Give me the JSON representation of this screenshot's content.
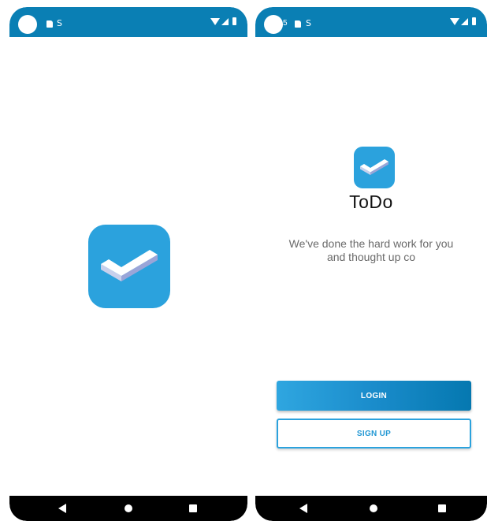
{
  "left_screen": {
    "status_bar": {
      "icons": [
        "camera-cutout",
        "sd-card-icon",
        "s-icon",
        "wifi-icon",
        "signal-icon",
        "battery-icon"
      ]
    },
    "splash_logo": "todo-check-icon",
    "nav_bar": {
      "icons": [
        "back-icon",
        "home-icon",
        "recents-icon"
      ]
    }
  },
  "right_screen": {
    "status_bar": {
      "time_fragment": "5",
      "icons": [
        "camera-cutout",
        "sd-card-icon",
        "s-icon",
        "wifi-icon",
        "signal-icon",
        "battery-icon"
      ]
    },
    "logo": "todo-check-icon",
    "app_name": "ToDo",
    "tagline": "We've done the hard work for you and thought up co",
    "login_label": "LOGIN",
    "signup_label": "SIGN UP",
    "nav_bar": {
      "icons": [
        "back-icon",
        "home-icon",
        "recents-icon"
      ]
    }
  },
  "colors": {
    "status_bar": "#0a7fb4",
    "brand_blue": "#2ba2dd",
    "login_gradient_start": "#2fa6e0",
    "login_gradient_end": "#0578b0",
    "signup_text": "#2398d4",
    "tagline_text": "#6a6a6a",
    "nav_bar": "#000000"
  }
}
